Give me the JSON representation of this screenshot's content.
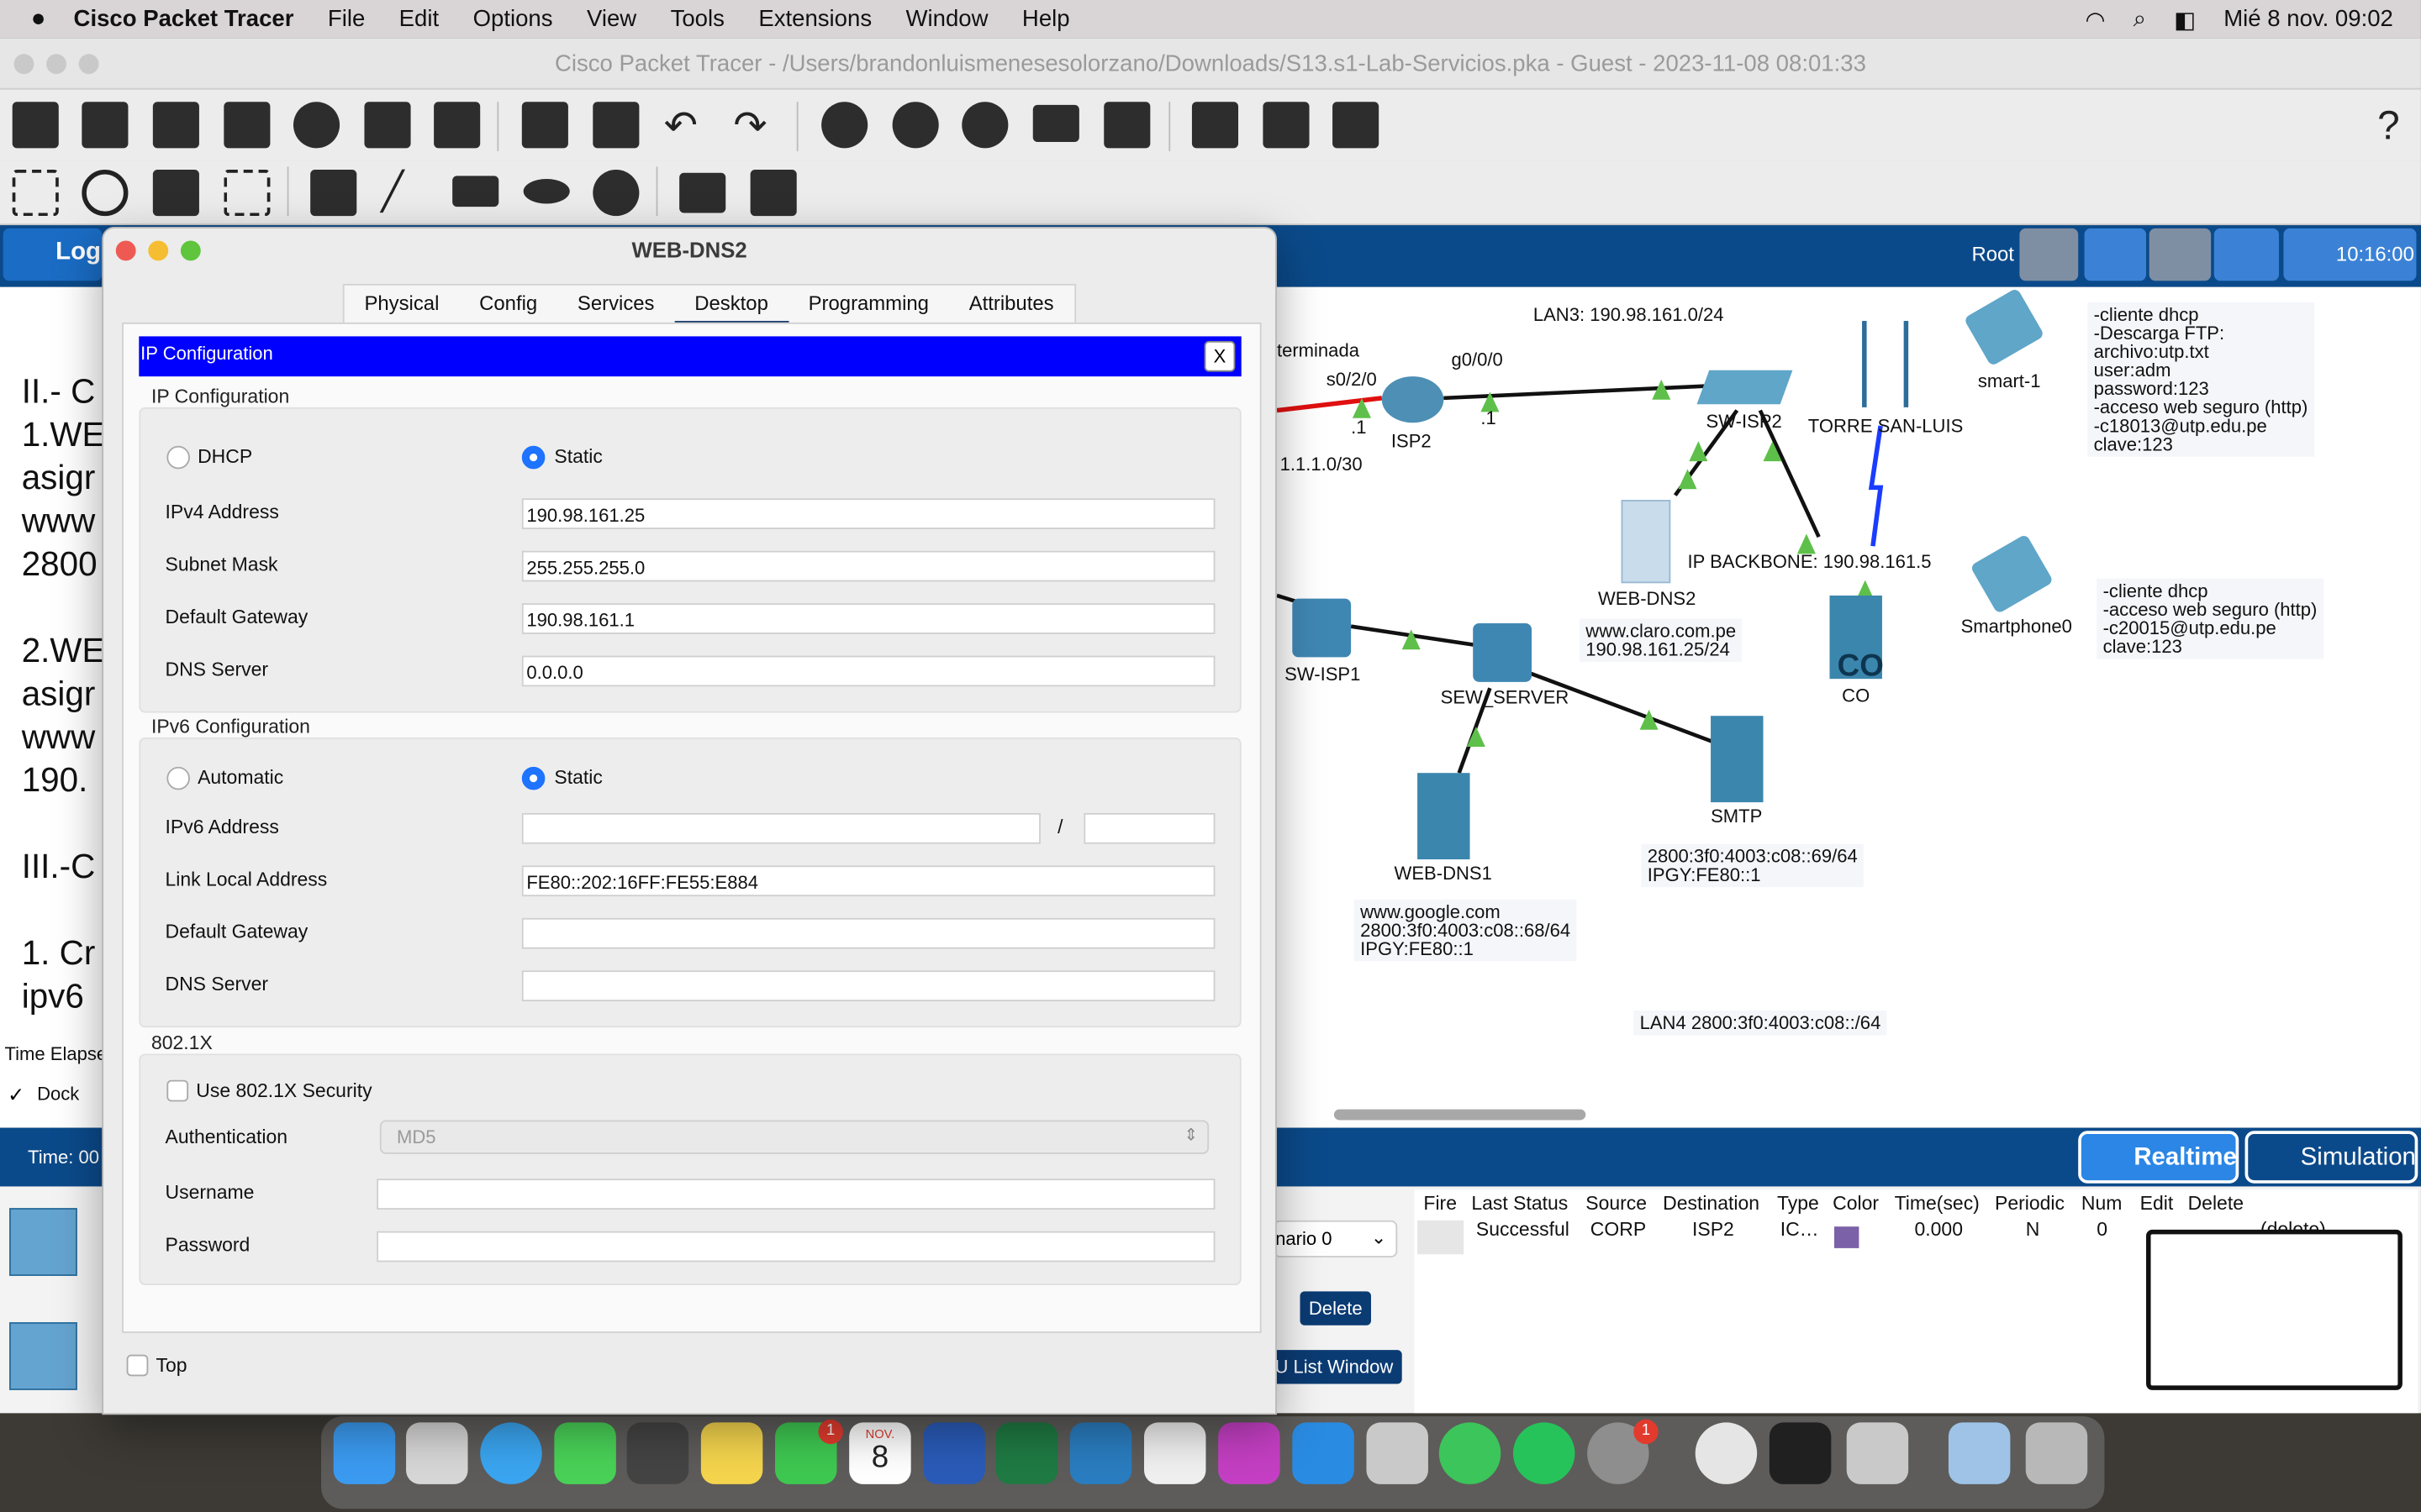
{
  "menubar": {
    "app": "Cisco Packet Tracer",
    "items": [
      "File",
      "Edit",
      "Options",
      "View",
      "Tools",
      "Extensions",
      "Window",
      "Help"
    ],
    "clock": "Mié 8 nov.  09:02"
  },
  "window": {
    "title": "Cisco Packet Tracer - /Users/brandonluismenesesolorzano/Downloads/S13.s1-Lab-Servicios.pka - Guest - 2023-11-08 08:01:33"
  },
  "logical_bar": {
    "tab": "Log",
    "root": "Root",
    "time": "10:16:00"
  },
  "dialog": {
    "title": "WEB-DNS2",
    "tabs": [
      "Physical",
      "Config",
      "Services",
      "Desktop",
      "Programming",
      "Attributes"
    ],
    "active_tab": "Desktop",
    "header": "IP Configuration",
    "close": "X",
    "ipv4_section": "IP Configuration",
    "dhcp": "DHCP",
    "static": "Static",
    "ipv4_address_label": "IPv4 Address",
    "ipv4_address": "190.98.161.25",
    "subnet_label": "Subnet Mask",
    "subnet": "255.255.255.0",
    "gateway_label": "Default Gateway",
    "gateway": "190.98.161.1",
    "dns_label": "DNS Server",
    "dns": "0.0.0.0",
    "ipv6_section": "IPv6 Configuration",
    "automatic": "Automatic",
    "static6": "Static",
    "ipv6_address_label": "IPv6 Address",
    "slash": "/",
    "link_local_label": "Link Local Address",
    "link_local": "FE80::202:16FF:FE55:E884",
    "gateway6_label": "Default Gateway",
    "dns6_label": "DNS Server",
    "dot1x_section": "802.1X",
    "use_8021x": "Use 802.1X Security",
    "auth_label": "Authentication",
    "auth_value": "MD5",
    "username_label": "Username",
    "password_label": "Password",
    "top": "Top"
  },
  "left_text": [
    "II.- C",
    "1.WE",
    "asigr",
    "www",
    "2800",
    "",
    "2.WE",
    "asigr",
    "www",
    "190.",
    "",
    "III.-C",
    "",
    "1. Cr",
    "ipv6"
  ],
  "network": {
    "lan3": "LAN3: 190.98.161.0/24",
    "terminada": "terminada",
    "s0_2_0": "s0/2/0",
    "g0_0_0": "g0/0/0",
    "dot1a": ".1",
    "dot1b": ".1",
    "isp2": "ISP2",
    "net1": "1.1.1.0/30",
    "sw_isp2": "SW-ISP2",
    "torre": "TORRE SAN-LUIS",
    "smart1": "smart-1",
    "web_dns2": "WEB-DNS2",
    "backbone": "IP BACKBONE: 190.98.161.5",
    "sw_isp1": "SW-ISP1",
    "sew_server": "SEW_SERVER",
    "co": "CO",
    "co_badge": "CO",
    "smartphone0": "Smartphone0",
    "web_dns1": "WEB-DNS1",
    "smtp": "SMTP",
    "lan4": "LAN4 2800:3f0:4003:c08::/64",
    "note_smart1": "-cliente dhcp\n-Descarga FTP:\narchivo:utp.txt\nuser:adm\npassword:123\n-acceso web seguro (http)\n-c18013@utp.edu.pe\nclave:123",
    "note_smartphone0": "-cliente dhcp\n-acceso web seguro (http)\n-c20015@utp.edu.pe\nclave:123",
    "note_claro": "www.claro.com.pe\n190.98.161.25/24",
    "note_smtp": "2800:3f0:4003:c08::69/64\nIPGY:FE80::1",
    "note_google": "www.google.com\n2800:3f0:4003:c08::68/64\nIPGY:FE80::1"
  },
  "bottom": {
    "time_elapsed": "Time Elapse",
    "dock": "Dock",
    "time": "Time: 00",
    "realtime": "Realtime",
    "simulation": "Simulation",
    "scenario": "nario 0",
    "delete": "Delete",
    "list_window": "U List Window",
    "pdu_headers": [
      "Fire",
      "Last Status",
      "Source",
      "Destination",
      "Type",
      "Color",
      "Time(sec)",
      "Periodic",
      "Num",
      "Edit",
      "Delete"
    ],
    "pdu_row": {
      "status": "Successful",
      "source": "CORP",
      "destination": "ISP2",
      "type": "IC…",
      "time": "0.000",
      "periodic": "N",
      "num": "0",
      "delete": "(delete)"
    }
  },
  "dock": {
    "calendar_month": "NOV.",
    "calendar_day": "8",
    "badge1": "1",
    "badge2": "1"
  },
  "colors": {
    "accent_blue": "#0000ff",
    "radio_blue": "#1e73ff",
    "pt_blue": "#0b4a8a"
  }
}
